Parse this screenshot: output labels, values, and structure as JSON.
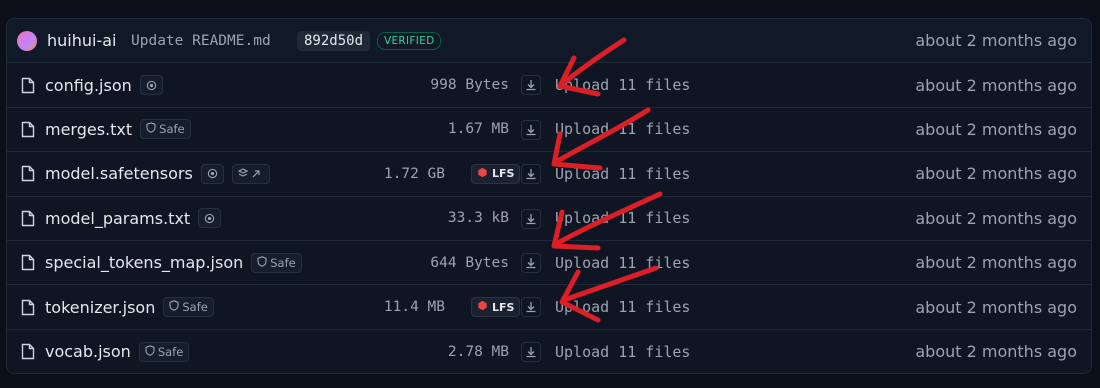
{
  "commit": {
    "author": "huihui-ai",
    "message": "Update README.md",
    "hash": "892d50d",
    "verified_label": "VERIFIED",
    "time": "about 2 months ago"
  },
  "files": [
    {
      "name": "config.json",
      "badge": "",
      "has_inference_icon": true,
      "size": "998 Bytes",
      "lfs": false,
      "commit": "Upload 11 files",
      "time": "about 2 months ago"
    },
    {
      "name": "merges.txt",
      "badge": "Safe",
      "has_inference_icon": false,
      "size": "1.67 MB",
      "lfs": false,
      "commit": "Upload 11 files",
      "time": "about 2 months ago"
    },
    {
      "name": "model.safetensors",
      "badge": "",
      "has_inference_icon": true,
      "size": "1.72 GB",
      "lfs": true,
      "commit": "Upload 11 files",
      "time": "about 2 months ago"
    },
    {
      "name": "model_params.txt",
      "badge": "",
      "has_inference_icon": true,
      "size": "33.3 kB",
      "lfs": false,
      "commit": "Upload 11 files",
      "time": "about 2 months ago"
    },
    {
      "name": "special_tokens_map.json",
      "badge": "Safe",
      "has_inference_icon": false,
      "size": "644 Bytes",
      "lfs": false,
      "commit": "Upload 11 files",
      "time": "about 2 months ago"
    },
    {
      "name": "tokenizer.json",
      "badge": "Safe",
      "has_inference_icon": false,
      "size": "11.4 MB",
      "lfs": true,
      "commit": "Upload 11 files",
      "time": "about 2 months ago"
    },
    {
      "name": "vocab.json",
      "badge": "Safe",
      "has_inference_icon": false,
      "size": "2.78 MB",
      "lfs": false,
      "commit": "Upload 11 files",
      "time": "about 2 months ago"
    }
  ],
  "lfs_label": "LFS",
  "colors": {
    "annotation_arrow": "#dc1f26",
    "verified": "#34d399",
    "background": "#0b0f19"
  }
}
